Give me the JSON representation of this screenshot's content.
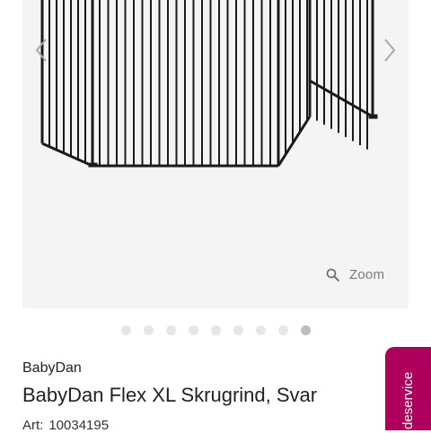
{
  "gallery": {
    "image_alt": "BabyDan Flex XL Skrugrind, Sort",
    "prev_icon": "chevron-left-icon",
    "next_icon": "chevron-right-icon",
    "zoom_icon": "magnifier-icon",
    "zoom_label": "Zoom",
    "slide_count": 9,
    "active_slide": 9
  },
  "product": {
    "brand": "BabyDan",
    "title": "BabyDan Flex XL Skrugrind, Svar",
    "art_label": "Art:",
    "art_number": "10034195"
  },
  "service_tab": {
    "label": "deservice",
    "color": "#b0005e"
  }
}
